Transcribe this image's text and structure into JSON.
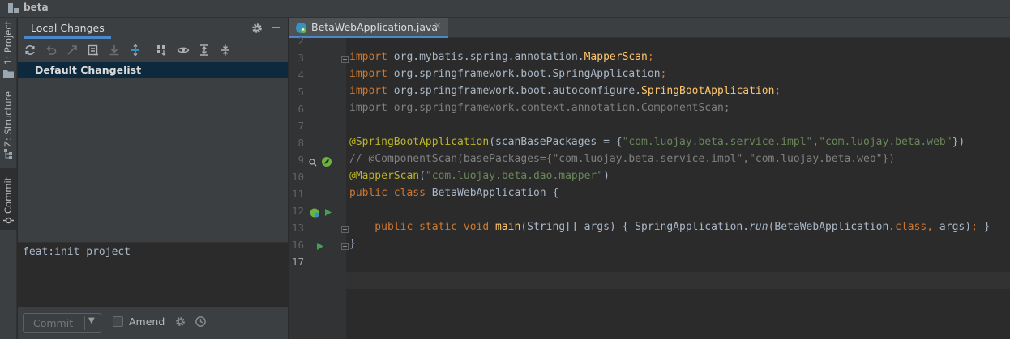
{
  "title_bar": {
    "project_name": "beta"
  },
  "tool_stripe": {
    "tabs": [
      {
        "label": "1: Project",
        "icon": "folder-icon"
      },
      {
        "label": "Z: Structure",
        "icon": "structure-icon"
      },
      {
        "label": "Commit",
        "icon": "commit-icon",
        "active": true
      }
    ]
  },
  "commit_panel": {
    "tab_label": "Local Changes",
    "toolbar_icons": [
      "refresh-icon",
      "rollback-icon",
      "show-diff-icon",
      "shelve-icon",
      "unshelve-icon",
      "move-changelist-icon",
      "group-by-icon",
      "view-options-icon",
      "expand-all-icon",
      "collapse-all-icon"
    ],
    "changelist": "Default Changelist",
    "commit_message": "feat:init project",
    "commit_button": "Commit",
    "amend_label": "Amend",
    "amend_checked": false
  },
  "editor": {
    "file_tab": "BetaWebApplication.java",
    "current_line": "17",
    "lines": [
      {
        "n": "2",
        "segs": []
      },
      {
        "n": "3",
        "segs": [
          {
            "t": "import ",
            "c": "kw"
          },
          {
            "t": "org.mybatis.spring.annotation.",
            "c": ""
          },
          {
            "t": "MapperScan",
            "c": "fn"
          },
          {
            "t": ";",
            "c": "kw"
          }
        ]
      },
      {
        "n": "4",
        "segs": [
          {
            "t": "import ",
            "c": "kw"
          },
          {
            "t": "org.springframework.boot.SpringApplication",
            "c": ""
          },
          {
            "t": ";",
            "c": "kw"
          }
        ]
      },
      {
        "n": "5",
        "segs": [
          {
            "t": "import ",
            "c": "kw"
          },
          {
            "t": "org.springframework.boot.autoconfigure.",
            "c": ""
          },
          {
            "t": "SpringBootApplication",
            "c": "fn"
          },
          {
            "t": ";",
            "c": "kw"
          }
        ]
      },
      {
        "n": "6",
        "segs": [
          {
            "t": "import org.springframework.context.annotation.ComponentScan;",
            "c": "dim"
          }
        ]
      },
      {
        "n": "7",
        "segs": []
      },
      {
        "n": "8",
        "segs": [
          {
            "t": "@SpringBootApplication",
            "c": "ann"
          },
          {
            "t": "(scanBasePackages = {",
            "c": ""
          },
          {
            "t": "\"com.luojay.beta.service.impl\"",
            "c": "str"
          },
          {
            "t": ",",
            "c": "kw"
          },
          {
            "t": "\"com.luojay.beta.web\"",
            "c": "str"
          },
          {
            "t": "})",
            "c": ""
          }
        ]
      },
      {
        "n": "9",
        "segs": [
          {
            "t": "// @ComponentScan(basePackages={\"com.luojay.beta.service.impl\",\"com.luojay.beta.web\"})",
            "c": "cmt"
          }
        ]
      },
      {
        "n": "10",
        "segs": [
          {
            "t": "@MapperScan",
            "c": "ann"
          },
          {
            "t": "(",
            "c": ""
          },
          {
            "t": "\"com.luojay.beta.dao.mapper\"",
            "c": "str"
          },
          {
            "t": ")",
            "c": ""
          }
        ]
      },
      {
        "n": "11",
        "segs": [
          {
            "t": "public class ",
            "c": "kw"
          },
          {
            "t": "BetaWebApplication {",
            "c": ""
          }
        ]
      },
      {
        "n": "12",
        "segs": []
      },
      {
        "n": "13",
        "segs": [
          {
            "t": "    public static void ",
            "c": "kw"
          },
          {
            "t": "main",
            "c": "fn"
          },
          {
            "t": "(String[] args) { SpringApplication.",
            "c": ""
          },
          {
            "t": "run",
            "c": "it"
          },
          {
            "t": "(BetaWebApplication.",
            "c": ""
          },
          {
            "t": "class",
            "c": "kw"
          },
          {
            "t": ", ",
            "c": "kw"
          },
          {
            "t": "args)",
            "c": ""
          },
          {
            "t": ";",
            "c": "kw"
          },
          {
            "t": " }",
            "c": ""
          }
        ]
      },
      {
        "n": "16",
        "segs": [
          {
            "t": "}",
            "c": ""
          }
        ]
      },
      {
        "n": "17",
        "segs": []
      }
    ]
  }
}
